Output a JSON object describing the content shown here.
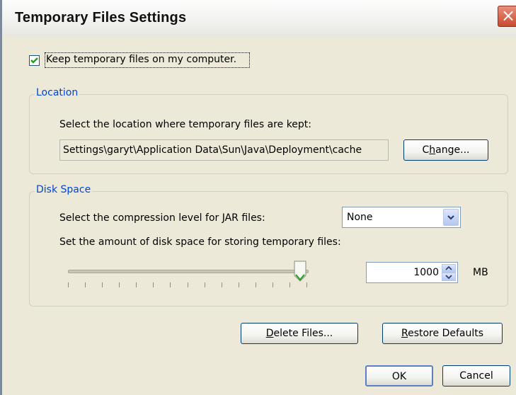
{
  "window": {
    "title": "Temporary Files Settings",
    "close_label": "×"
  },
  "keep": {
    "label": "Keep temporary files on my computer.",
    "checked": true
  },
  "location": {
    "legend": "Location",
    "description": "Select the location where temporary files are kept:",
    "path": "Settings\\garyt\\Application Data\\Sun\\Java\\Deployment\\cache",
    "change_prefix": "C",
    "change_ul": "h",
    "change_suffix": "ange..."
  },
  "disk": {
    "legend": "Disk Space",
    "compression_label": "Select the compression level for JAR files:",
    "compression_value": "None",
    "amount_label": "Set the amount of disk space for storing temporary files:",
    "amount_value": "1000",
    "unit": "MB",
    "slider_fraction": 1.0
  },
  "buttons": {
    "delete_ul": "D",
    "delete_rest": "elete Files...",
    "restore_ul": "R",
    "restore_rest": "estore Defaults",
    "ok": "OK",
    "cancel": "Cancel"
  },
  "colors": {
    "accent": "#0046d5",
    "dialog_bg": "#ece9d8",
    "close_red": "#c94a2f",
    "check_green": "#21a121"
  }
}
